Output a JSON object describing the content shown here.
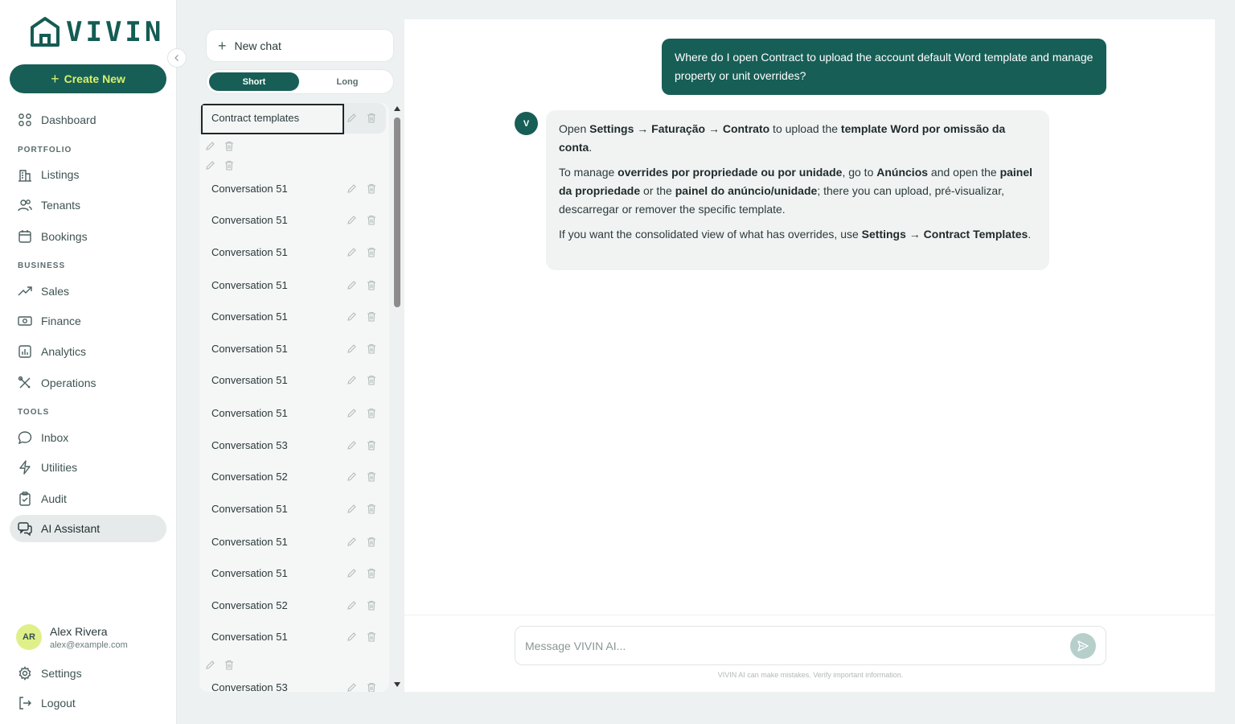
{
  "brand": {
    "name": "VIVIN",
    "accent": "#175e56",
    "highlight": "#d8f06a"
  },
  "sidebar": {
    "create_label": "Create New",
    "dashboard": "Dashboard",
    "sections": {
      "portfolio": "PORTFOLIO",
      "business": "BUSINESS",
      "tools": "TOOLS"
    },
    "items": {
      "listings": "Listings",
      "tenants": "Tenants",
      "bookings": "Bookings",
      "sales": "Sales",
      "finance": "Finance",
      "analytics": "Analytics",
      "operations": "Operations",
      "inbox": "Inbox",
      "utilities": "Utilities",
      "audit": "Audit",
      "ai_assistant": "AI Assistant"
    },
    "user": {
      "initials": "AR",
      "name": "Alex Rivera",
      "email": "alex@example.com"
    },
    "settings": "Settings",
    "logout": "Logout"
  },
  "chat_panel": {
    "new_chat": "New chat",
    "modes": {
      "short": "Short",
      "long": "Long",
      "selected": "Short"
    },
    "conversations": [
      "Contract templates",
      "",
      "",
      "Conversation 51",
      "Conversation 51",
      "Conversation 51",
      "Conversation 51",
      "Conversation 51",
      "Conversation 51",
      "Conversation 51",
      "Conversation 51",
      "Conversation 53",
      "Conversation 52",
      "Conversation 51",
      "Conversation 51",
      "Conversation 51",
      "Conversation 52",
      "Conversation 51",
      "",
      "Conversation 53"
    ]
  },
  "conversation": {
    "user_message": "Where do I open Contract to upload the account default Word template and manage property or unit overrides?",
    "assistant_avatar": "V",
    "assistant": {
      "p1_a": "Open ",
      "p1_b": "Settings → Faturação → Contrato",
      "p1_c": " to upload the ",
      "p1_d": "template Word por omissão da conta",
      "p1_e": ".",
      "p2_a": "To manage ",
      "p2_b": "overrides por propriedade ou por unidade",
      "p2_c": ", go to ",
      "p2_d": "Anúncios",
      "p2_e": " and open the ",
      "p2_f": "painel da propriedade",
      "p2_g": " or the ",
      "p2_h": "painel do anúncio/unidade",
      "p2_i": "; there you can upload, pré-visualizar, descarregar or remover the specific template.",
      "p3_a": "If you want the consolidated view of what has overrides, use ",
      "p3_b": "Settings → Contract Templates",
      "p3_c": "."
    }
  },
  "composer": {
    "placeholder": "Message VIVIN AI...",
    "disclaimer": "VIVIN AI can make mistakes. Verify important information."
  }
}
